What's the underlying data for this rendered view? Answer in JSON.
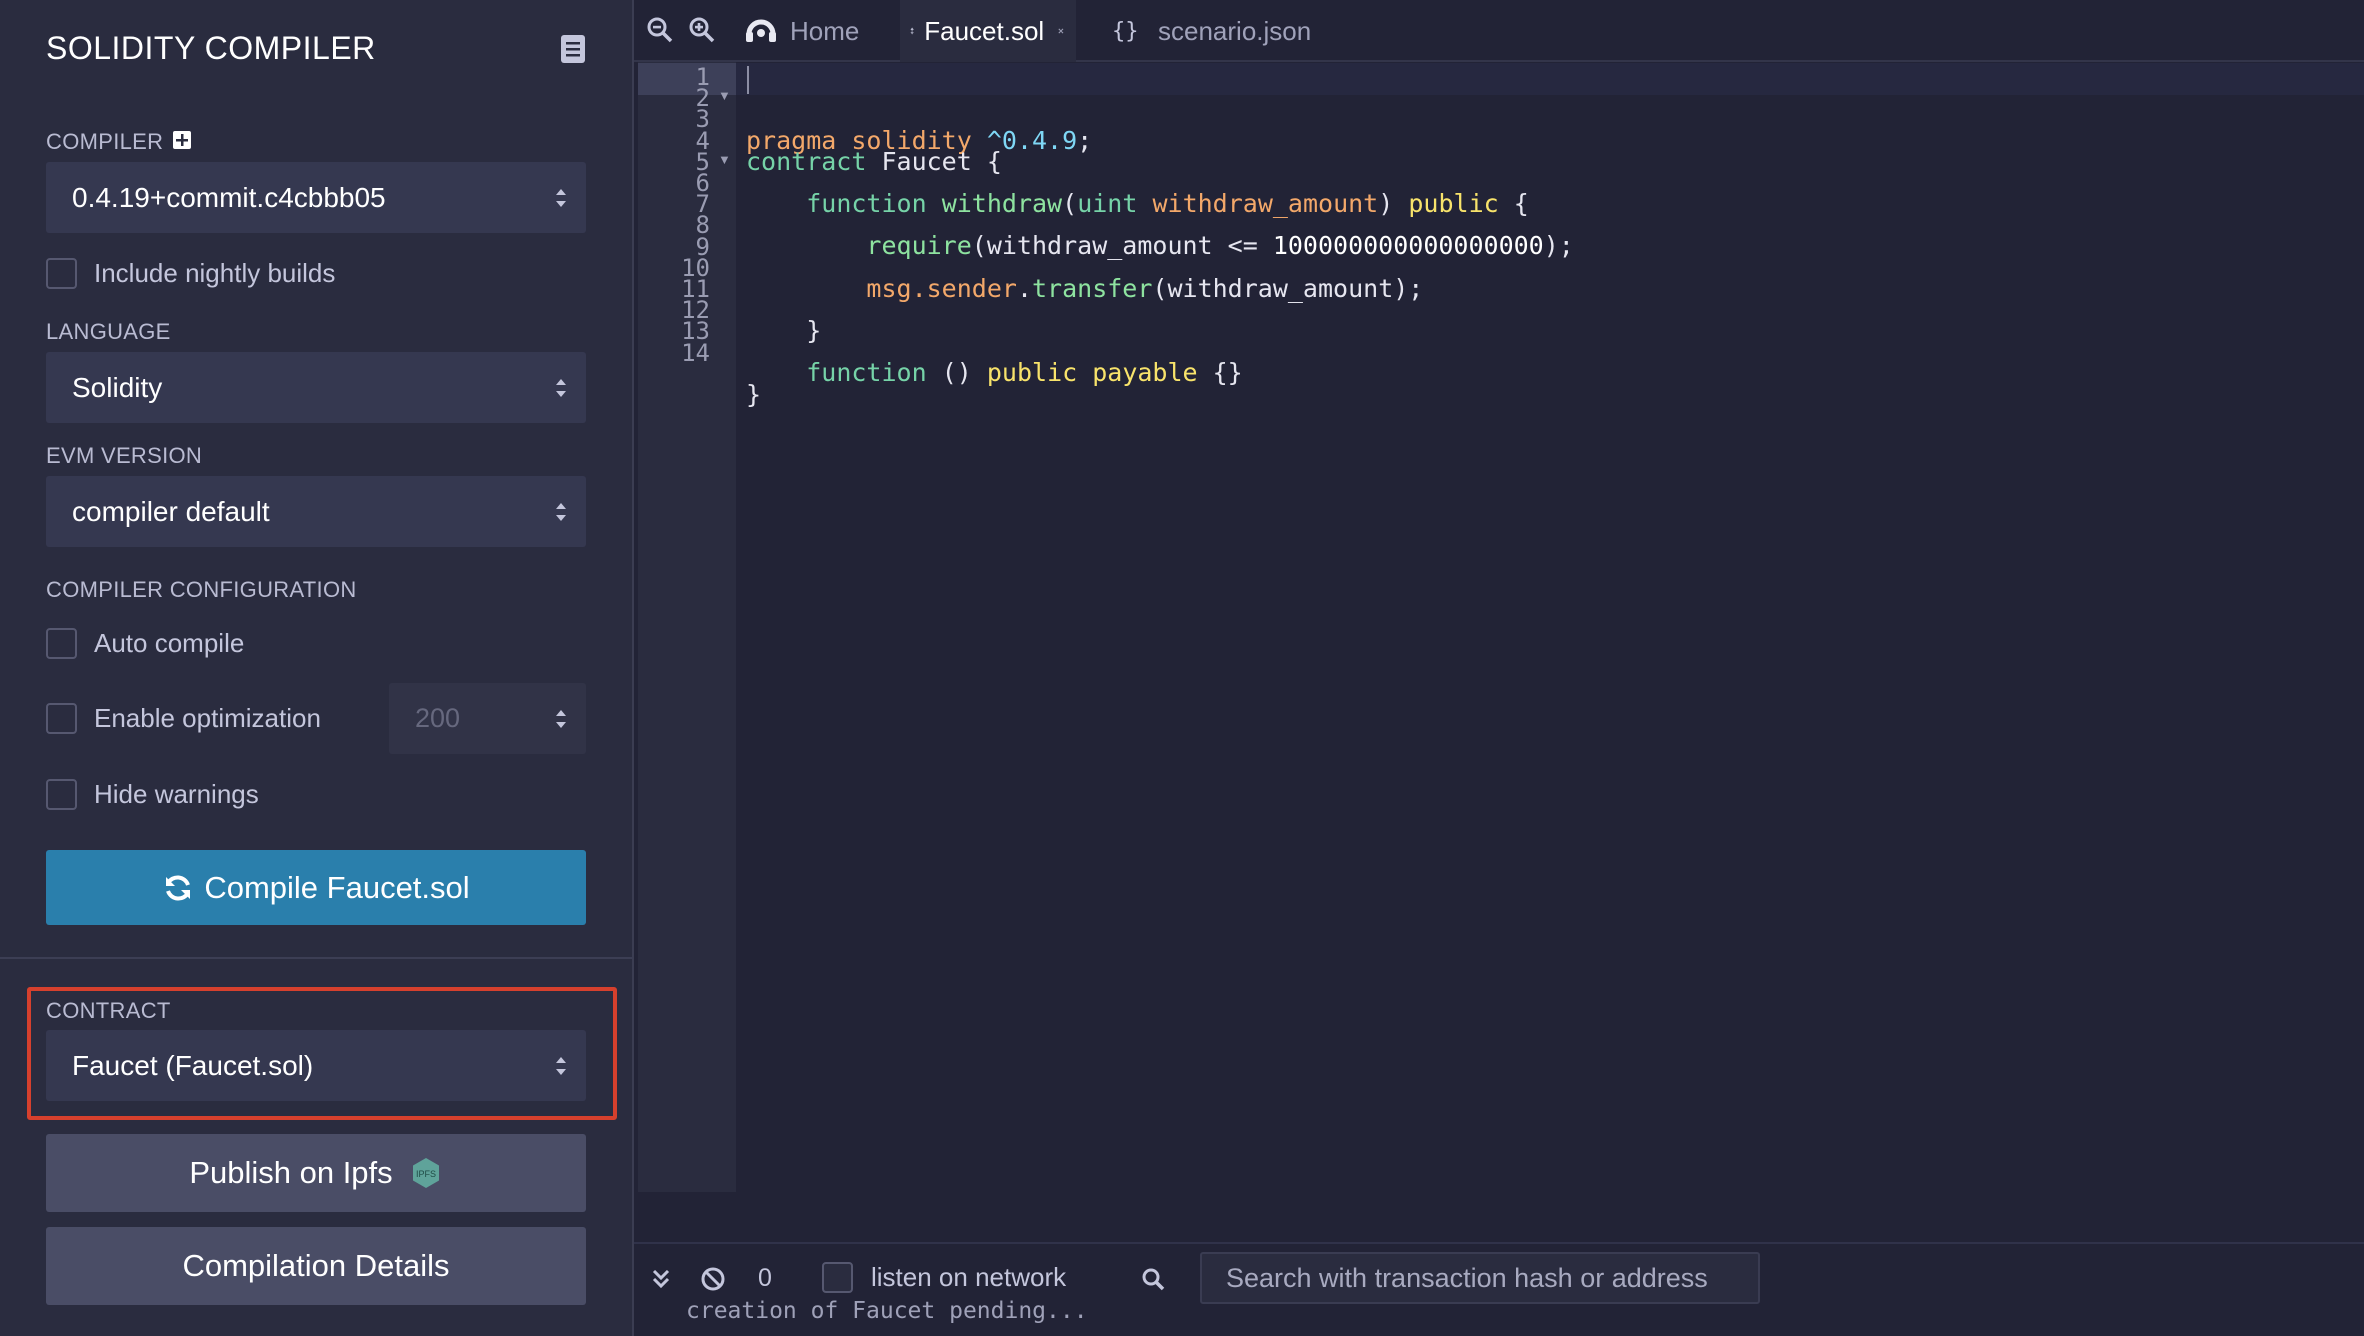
{
  "side_panel": {
    "title": "SOLIDITY COMPILER",
    "compiler_label": "COMPILER",
    "compiler_version": "0.4.19+commit.c4cbbb05",
    "nightly_label": "Include nightly builds",
    "language_label": "LANGUAGE",
    "language_value": "Solidity",
    "evm_label": "EVM VERSION",
    "evm_value": "compiler default",
    "config_label": "COMPILER CONFIGURATION",
    "auto_compile_label": "Auto compile",
    "optimization_label": "Enable optimization",
    "optimization_runs": "200",
    "hide_warnings_label": "Hide warnings",
    "compile_button": "Compile Faucet.sol",
    "contract_label": "CONTRACT",
    "contract_value": "Faucet (Faucet.sol)",
    "publish_button": "Publish on Ipfs",
    "ipfs_badge": "IPFS",
    "details_button": "Compilation Details"
  },
  "tabs": [
    {
      "label": "Home",
      "icon": "remix-logo-icon"
    },
    {
      "label": "Faucet.sol",
      "icon": "solidity-file-icon",
      "active": true
    },
    {
      "label": "scenario.json",
      "icon": "json-file-icon"
    }
  ],
  "editor": {
    "line_numbers": [
      "1",
      "2",
      "3",
      "4",
      "5",
      "6",
      "7",
      "8",
      "9",
      "10",
      "11",
      "12",
      "13",
      "14"
    ],
    "lines": [
      "",
      "pragma solidity ^0.4.9;",
      "contract Faucet {",
      "",
      "    function withdraw(uint withdraw_amount) public {",
      "",
      "        require(withdraw_amount <= 100000000000000000);",
      "",
      "        msg.sender.transfer(withdraw_amount);",
      "",
      "    }",
      "",
      "    function () public payable {}",
      "}"
    ]
  },
  "terminal": {
    "count": "0",
    "listen_label": "listen on network",
    "search_placeholder": "Search with transaction hash or address",
    "output": "creation of Faucet pending..."
  },
  "colors": {
    "compile_button": "#2a7fac",
    "highlight_border": "#d6402d"
  }
}
